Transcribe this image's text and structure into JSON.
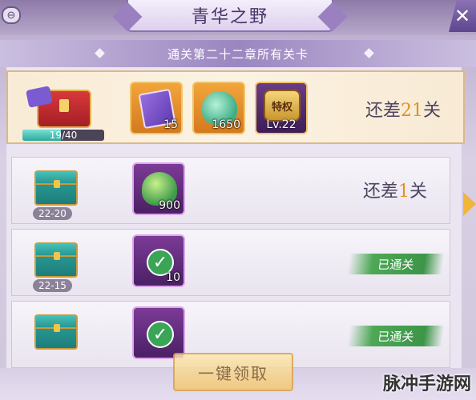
{
  "window": {
    "title": "青华之野",
    "back_icon": "back-icon",
    "close_icon": "close-icon",
    "close_glyph": "✕",
    "back_glyph": "⊖"
  },
  "subtitle": "通关第二十二章所有关卡",
  "top_row": {
    "progress_text": "19/40",
    "progress_fraction": 0.475,
    "items": [
      {
        "icon": "ticket-icon",
        "count": "15"
      },
      {
        "icon": "jade-icon",
        "count": "1650"
      },
      {
        "icon": "privilege-badge-icon",
        "badge_text": "特权",
        "count": "Lv.22"
      }
    ],
    "status_prefix": "还差",
    "status_num": "21",
    "status_suffix": "关"
  },
  "rows": [
    {
      "label": "22-20",
      "item_icon": "green-orb-icon",
      "item_count": "900",
      "status_prefix": "还差",
      "status_num": "1",
      "status_suffix": "关",
      "done": false
    },
    {
      "label": "22-15",
      "item_icon": "red-gem-icon",
      "item_count": "10",
      "done_text": "已通关",
      "done": true
    },
    {
      "label": "",
      "item_icon": "gray-orb-icon",
      "item_count": "",
      "done_text": "已通关",
      "done": true
    }
  ],
  "claim_button": "一键领取",
  "watermark": "脉冲手游网",
  "colors": {
    "accent": "#e0921d",
    "done_green": "#4da856",
    "panel_purple": "#8e7aa8"
  }
}
